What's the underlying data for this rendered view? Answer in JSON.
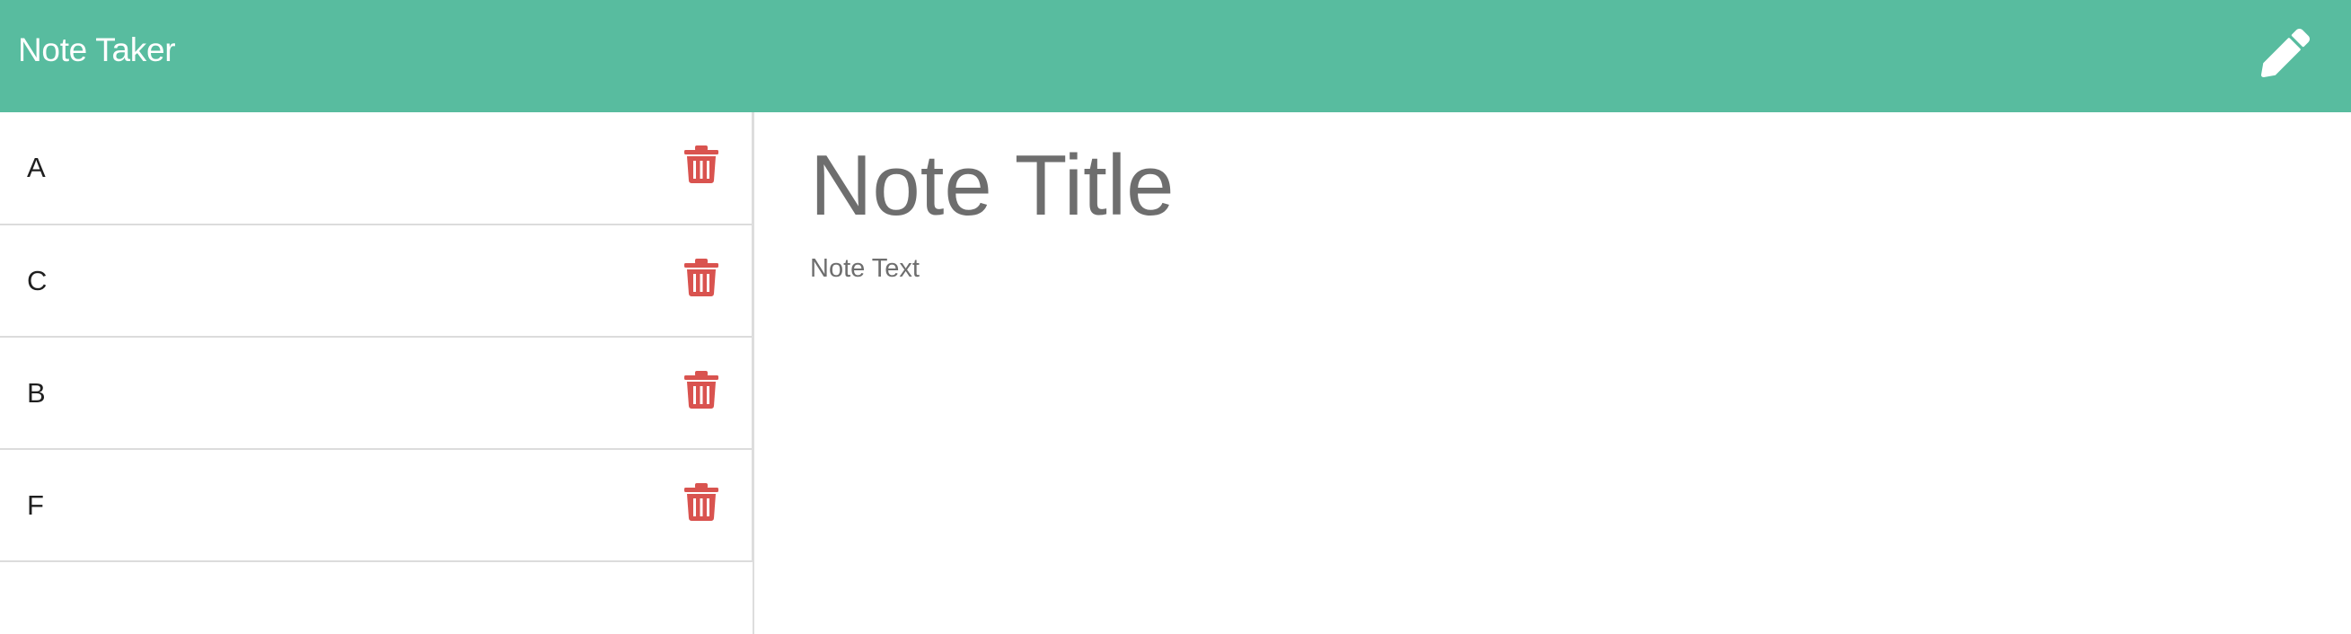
{
  "app": {
    "title": "Note Taker"
  },
  "header": {
    "new_note_icon": "pencil-icon"
  },
  "colors": {
    "header_bg": "#58bc9f",
    "delete_icon": "#d9534f",
    "placeholder_text": "#6e6e6e"
  },
  "notes": [
    {
      "title": "A",
      "delete_icon": "trash-icon"
    },
    {
      "title": "C",
      "delete_icon": "trash-icon"
    },
    {
      "title": "B",
      "delete_icon": "trash-icon"
    },
    {
      "title": "F",
      "delete_icon": "trash-icon"
    }
  ],
  "editor": {
    "title_placeholder": "Note Title",
    "title_value": "",
    "text_placeholder": "Note Text",
    "text_value": ""
  }
}
